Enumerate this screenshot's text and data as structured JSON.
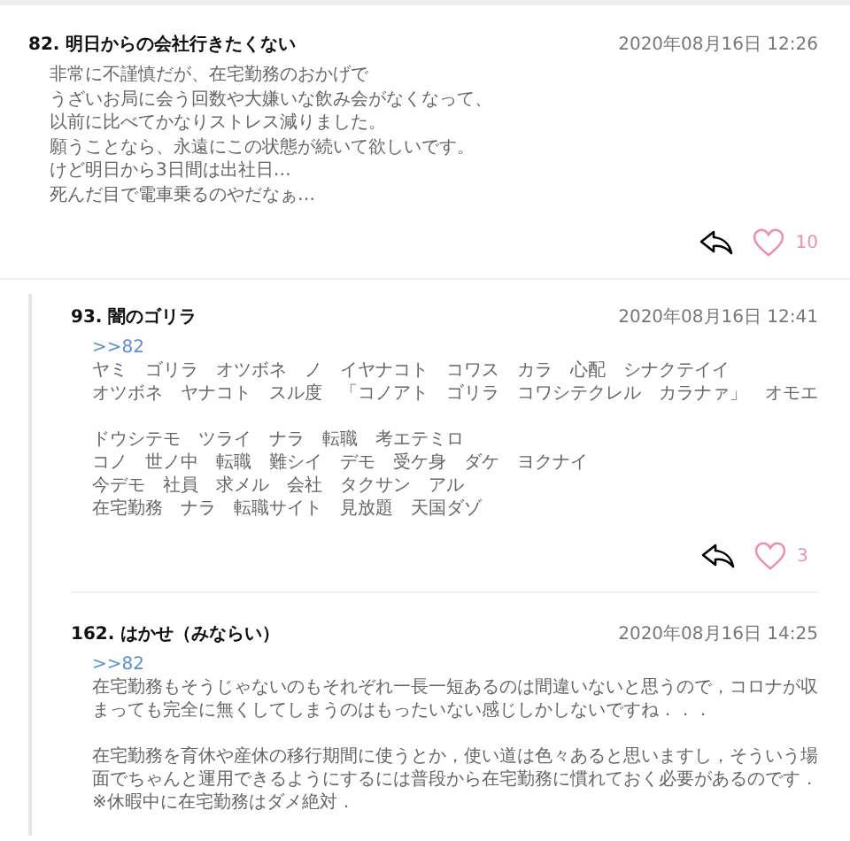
{
  "comments": [
    {
      "number": "82.",
      "name": "明日からの会社行きたくない",
      "date": "2020年08月16日 12:26",
      "paragraphs": [
        [
          "非常に不謹慎だが、在宅勤務のおかげで",
          "うざいお局に会う回数や大嫌いな飲み会がなくなって、",
          "以前に比べてかなりストレス減りました。",
          "願うことなら、永遠にこの状態が続いて欲しいです。",
          "けど明日から3日間は出社日…",
          "死んだ目で電車乗るのやだなぁ…"
        ]
      ],
      "likes": "10",
      "replies": [
        {
          "number": "93.",
          "name": "闇のゴリラ",
          "date": "2020年08月16日 12:41",
          "anchor": ">>82",
          "paragraphs": [
            [
              "ヤミ　ゴリラ　オツボネ　ノ　イヤナコト　コワス　カラ　心配　シナクテイイ",
              "オツボネ　ヤナコト　スル度　「コノアト　ゴリラ　コワシテクレル　カラナァ」　オモエ"
            ],
            [
              "ドウシテモ　ツライ　ナラ　転職　考エテミロ",
              "コノ　世ノ中　転職　難シイ　デモ　受ケ身　ダケ　ヨクナイ",
              "今デモ　社員　求メル　会社　タクサン　アル",
              "在宅勤務　ナラ　転職サイト　見放題　天国ダゾ"
            ]
          ],
          "likes": "3"
        },
        {
          "number": "162.",
          "name": "はかせ（みならい）",
          "date": "2020年08月16日 14:25",
          "anchor": ">>82",
          "paragraphs": [
            [
              "在宅勤務もそうじゃないのもそれぞれ一長一短あるのは間違いないと思うので，コロナが収まっても完全に無くしてしまうのはもったいない感じしかしないですね．．．"
            ],
            [
              "在宅勤務を育休や産休の移行期間に使うとか，使い道は色々あると思いますし，そういう場面でちゃんと運用できるようにするには普段から在宅勤務に慣れておく必要があるのです．",
              "※休暇中に在宅勤務はダメ絶対．"
            ]
          ]
        }
      ]
    }
  ]
}
